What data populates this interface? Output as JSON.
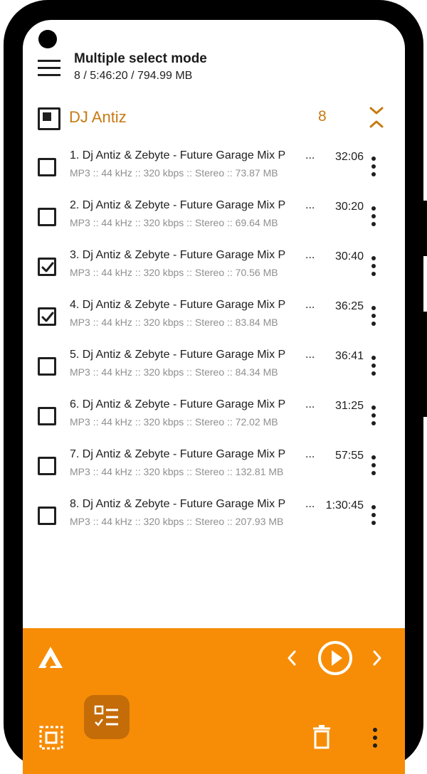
{
  "header": {
    "title": "Multiple select mode",
    "subtitle": "8 / 5:46:20 / 794.99 MB"
  },
  "group": {
    "name": "DJ Antiz",
    "count": "8"
  },
  "tracks": [
    {
      "title": "1. Dj Antiz & Zebyte - Future Garage Mix P",
      "meta": "MP3 :: 44 kHz :: 320 kbps :: Stereo :: 73.87 MB",
      "duration": "32:06",
      "checked": false
    },
    {
      "title": "2. Dj Antiz & Zebyte - Future Garage Mix P",
      "meta": "MP3 :: 44 kHz :: 320 kbps :: Stereo :: 69.64 MB",
      "duration": "30:20",
      "checked": false
    },
    {
      "title": "3. Dj Antiz & Zebyte - Future Garage Mix P",
      "meta": "MP3 :: 44 kHz :: 320 kbps :: Stereo :: 70.56 MB",
      "duration": "30:40",
      "checked": true
    },
    {
      "title": "4. Dj Antiz & Zebyte - Future Garage Mix P",
      "meta": "MP3 :: 44 kHz :: 320 kbps :: Stereo :: 83.84 MB",
      "duration": "36:25",
      "checked": true
    },
    {
      "title": "5. Dj Antiz & Zebyte - Future Garage Mix P",
      "meta": "MP3 :: 44 kHz :: 320 kbps :: Stereo :: 84.34 MB",
      "duration": "36:41",
      "checked": false
    },
    {
      "title": "6. Dj Antiz & Zebyte - Future Garage Mix P",
      "meta": "MP3 :: 44 kHz :: 320 kbps :: Stereo :: 72.02 MB",
      "duration": "31:25",
      "checked": false
    },
    {
      "title": "7. Dj Antiz & Zebyte - Future Garage Mix P",
      "meta": "MP3 :: 44 kHz :: 320 kbps :: Stereo :: 132.81 MB",
      "duration": "57:55",
      "checked": false
    },
    {
      "title": "8. Dj Antiz & Zebyte - Future Garage Mix P",
      "meta": "MP3 :: 44 kHz :: 320 kbps :: Stereo :: 207.93 MB",
      "duration": "1:30:45",
      "checked": false
    }
  ],
  "ellipsis": "...",
  "icons": {
    "menu": "hamburger-menu-icon",
    "group_checkbox": "partial-check-icon",
    "collapse": "collapse-expand-icon",
    "more": "more-vertical-icon",
    "app_logo": "aimp-logo-icon",
    "prev": "chevron-left-icon",
    "play": "play-circle-icon",
    "next": "chevron-right-icon",
    "select_all": "select-all-icon",
    "checklist": "checklist-icon",
    "delete": "trash-icon",
    "bottom_more": "more-vertical-icon"
  },
  "colors": {
    "accent": "#f78d06",
    "accent_dark": "#c46c08",
    "group_text": "#c77a12",
    "text": "#202020",
    "meta_text": "#8f8f8f"
  }
}
